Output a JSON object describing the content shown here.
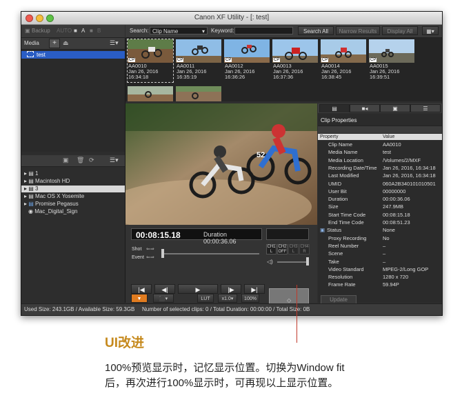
{
  "window": {
    "title": "Canon XF Utility - [: test]"
  },
  "toolbar": {
    "backup_label": "Backup",
    "auto_label": "AUTO",
    "a_label": "A",
    "b_label": "B",
    "search_label": "Search:",
    "search_value": "Clip Name",
    "keyword_label": "Keyword:",
    "keyword_value": "",
    "search_all_label": "Search All",
    "narrow_results_label": "Narrow Results",
    "display_all_label": "Display All"
  },
  "media_panel": {
    "label": "Media",
    "items": [
      {
        "label": "test"
      }
    ]
  },
  "drives": [
    {
      "label": "1"
    },
    {
      "label": "Macintosh HD"
    },
    {
      "label": "3"
    },
    {
      "label": "Mac OS X Yosemite"
    },
    {
      "label": "Promise Pegasus"
    },
    {
      "label": "Mac_Digital_Sign"
    }
  ],
  "clips": [
    {
      "name": "AA0010",
      "date": "Jan 26, 2016",
      "time": "16:34:18",
      "badge": "CP"
    },
    {
      "name": "AA0011",
      "date": "Jan 26, 2016",
      "time": "16:35:19",
      "badge": "CP"
    },
    {
      "name": "AA0012",
      "date": "Jan 26, 2016",
      "time": "16:36:26",
      "badge": "CP"
    },
    {
      "name": "AA0013",
      "date": "Jan 26, 2016",
      "time": "16:37:36",
      "badge": "CP"
    },
    {
      "name": "AA0014",
      "date": "Jan 26, 2016",
      "time": "16:38:45",
      "badge": "CP"
    },
    {
      "name": "AA0015",
      "date": "Jan 26, 2016",
      "time": "16:39:51",
      "badge": "CP"
    }
  ],
  "player": {
    "timecode": "00:08:15.18",
    "duration_label": "Duration",
    "duration_value": "00:00:36.06",
    "shot_label": "Shot",
    "event_label": "Event",
    "channels": [
      "CH1",
      "CH2",
      "CH3",
      "CH4"
    ],
    "channel_states": [
      "L",
      "OFF",
      "L",
      "R"
    ],
    "lut_label": "LUT",
    "speed_label": "x1.0",
    "zoom_label": "100%"
  },
  "properties": {
    "title": "Clip Properties",
    "col_property": "Property",
    "col_value": "Value",
    "rows": [
      {
        "k": "Clip Name",
        "v": "AA0010"
      },
      {
        "k": "Media Name",
        "v": "test"
      },
      {
        "k": "Media Location",
        "v": "/Volumes/2/MXF"
      },
      {
        "k": "Recording Date/Time",
        "v": "Jan 26, 2016, 16:34:18"
      },
      {
        "k": "Last Modified",
        "v": "Jan 26, 2016, 16:34:18"
      },
      {
        "k": "UMID",
        "v": "060A2B340101010501"
      },
      {
        "k": "User Bit",
        "v": "00000000"
      },
      {
        "k": "Duration",
        "v": "00:00:36.06"
      },
      {
        "k": "Size",
        "v": "247.9MB"
      },
      {
        "k": "Start Time Code",
        "v": "00:08:15.18"
      },
      {
        "k": "End Time Code",
        "v": "00:08:51.23"
      },
      {
        "k": "Status",
        "v": "None"
      },
      {
        "k": "Proxy Recording",
        "v": "No"
      },
      {
        "k": "Reel Number",
        "v": "–"
      },
      {
        "k": "Scene",
        "v": "–"
      },
      {
        "k": "Take",
        "v": "–"
      },
      {
        "k": "Video Standard",
        "v": "MPEG-2/Long GOP"
      },
      {
        "k": "Resolution",
        "v": "1280 x 720"
      },
      {
        "k": "Frame Rate",
        "v": "59.94P"
      }
    ],
    "update_label": "Update"
  },
  "status": {
    "used": "Used Size: 243.1GB / Available Size: 59.3GB",
    "summary": "Number of selected clips: 0 / Total Duration: 00:00:00 / Total Size: 0B"
  },
  "caption": {
    "heading": "UI改进",
    "line1": "100%预览显示时，记忆显示位置。切换为Window fit",
    "line2": "后，再次进行100%显示时，可再现以上显示位置。"
  }
}
